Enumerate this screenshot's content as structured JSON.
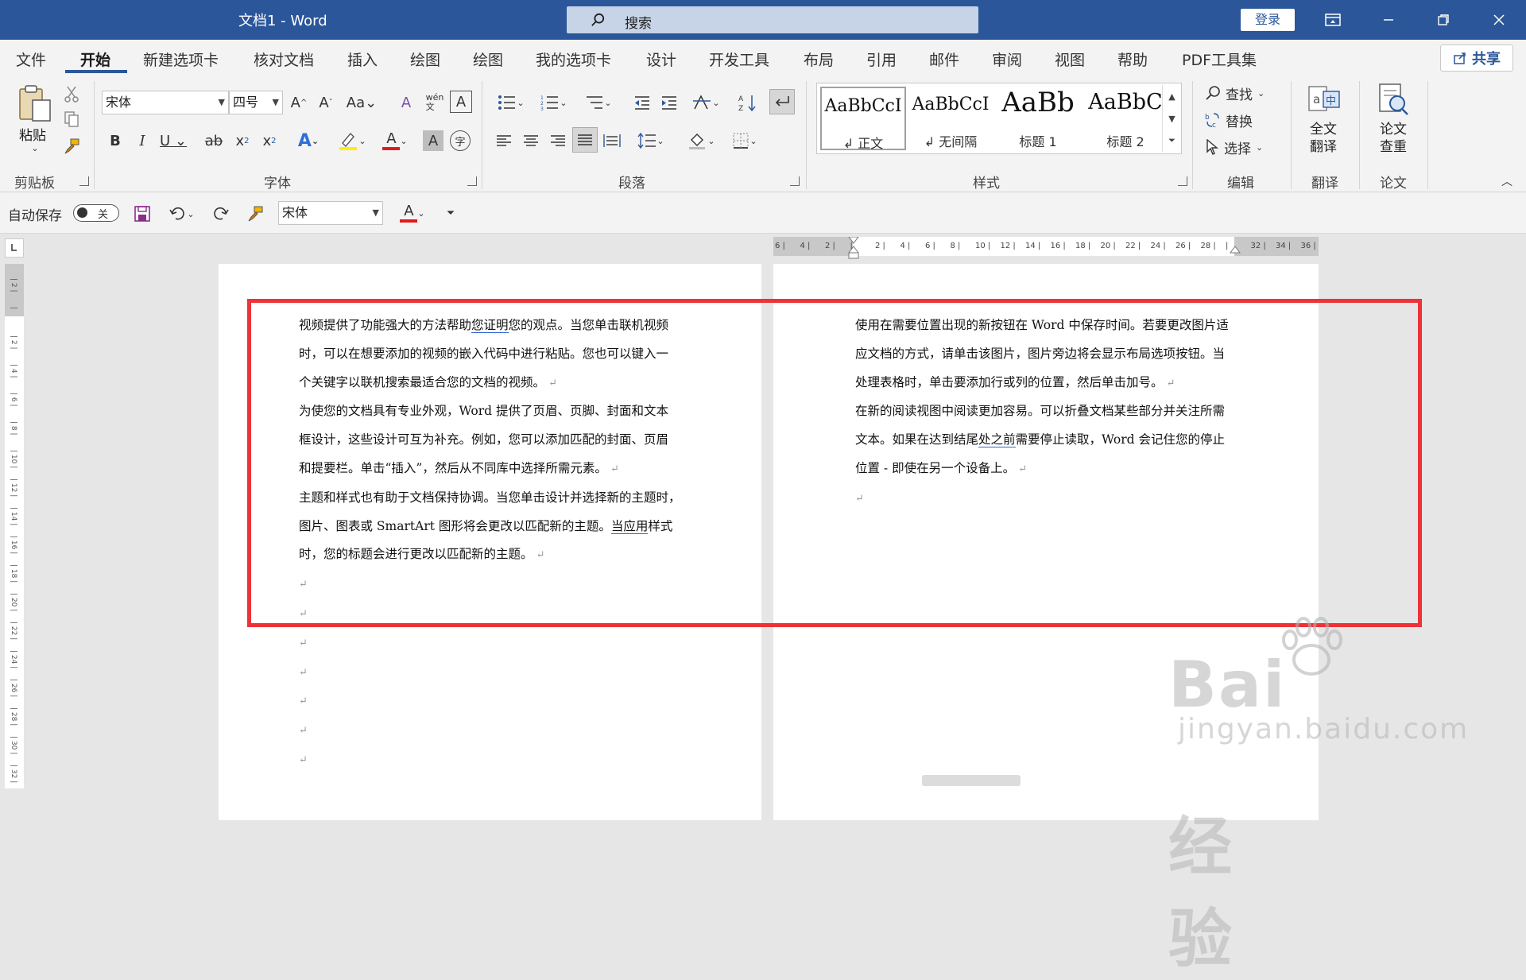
{
  "titlebar": {
    "doc_title": "文档1  -  Word",
    "search_placeholder": "搜索",
    "login_label": "登录"
  },
  "tabs": [
    "文件",
    "开始",
    "新建选项卡",
    "核对文档",
    "插入",
    "绘图",
    "绘图",
    "我的选项卡",
    "设计",
    "开发工具",
    "布局",
    "引用",
    "邮件",
    "审阅",
    "视图",
    "帮助",
    "PDF工具集"
  ],
  "share_label": "共享",
  "ribbon": {
    "clipboard": {
      "paste_label": "粘贴",
      "group_label": "剪贴板"
    },
    "font": {
      "font_name": "宋体",
      "font_size": "四号",
      "group_label": "字体"
    },
    "paragraph": {
      "group_label": "段落"
    },
    "styles": {
      "group_label": "样式",
      "items": [
        {
          "sample": "AaBbCcI",
          "name": "正文"
        },
        {
          "sample": "AaBbCcI",
          "name": "无间隔"
        },
        {
          "sample": "AaBb",
          "name": "标题 1"
        },
        {
          "sample": "AaBbC",
          "name": "标题 2"
        }
      ]
    },
    "editing": {
      "find": "查找",
      "replace": "替换",
      "select": "选择",
      "group_label": "编辑"
    },
    "translate": {
      "button": "全文\n翻译",
      "group_label": "翻译"
    },
    "paper": {
      "button": "论文\n查重",
      "group_label": "论文"
    }
  },
  "qat": {
    "autosave_label": "自动保存",
    "toggle_state": "关",
    "font_name": "宋体"
  },
  "doc": {
    "page1": {
      "paragraphs": [
        [
          "视频提供了功能强大的方法帮助",
          "您证明",
          "您的观点。当您单击联机视频"
        ],
        "时，可以在想要添加的视频的嵌入代码中进行粘贴。您也可以键入一",
        "个关键字以联机搜索最适合您的文档的视频。",
        "为使您的文档具有专业外观，Word 提供了页眉、页脚、封面和文本",
        "框设计，这些设计可互为补充。例如，您可以添加匹配的封面、页眉",
        "和提要栏。单击“插入”，然后从不同库中选择所需元素。",
        "主题和样式也有助于文档保持协调。当您单击设计并选择新的主题时，",
        [
          "图片、图表或 SmartArt 图形将会更改以匹配新的主题。",
          "当应用",
          "样式"
        ],
        "时，您的标题会进行更改以匹配新的主题。"
      ]
    },
    "page2": {
      "paragraphs": [
        "使用在需要位置出现的新按钮在 Word 中保存时间。若要更改图片适",
        "应文档的方式，请单击该图片，图片旁边将会显示布局选项按钮。当",
        "处理表格时，单击要添加行或列的位置，然后单击加号。",
        [
          "在新的阅读视图中阅读更加容易。可以折叠文档某些部分并关注所需",
          "",
          ""
        ],
        [
          "文本。如果在达到结尾",
          "处之前",
          "需要停止读取，Word 会记住您的停止"
        ],
        "位置 - 即使在另一个设备上。"
      ]
    },
    "hruler_ticks": [
      "6",
      "4",
      "2",
      "",
      "2",
      "4",
      "6",
      "8",
      "10",
      "12",
      "14",
      "16",
      "18",
      "20",
      "22",
      "24",
      "26",
      "28",
      "",
      "32",
      "34",
      "36"
    ],
    "vruler_ticks": [
      "2",
      "",
      "2",
      "4",
      "6",
      "8",
      "10",
      "12",
      "14",
      "16",
      "18",
      "20",
      "22",
      "24",
      "26",
      "28",
      "30",
      "32"
    ]
  },
  "watermark": {
    "main": "Bai",
    "logo_text": "经验",
    "sub": "jingyan.baidu.com"
  },
  "colors": {
    "title_bar": "#2b579a",
    "highlight_box": "#ee3238",
    "font_color_underline": "#e21a1a",
    "highlight_yellow": "#ffee00"
  }
}
